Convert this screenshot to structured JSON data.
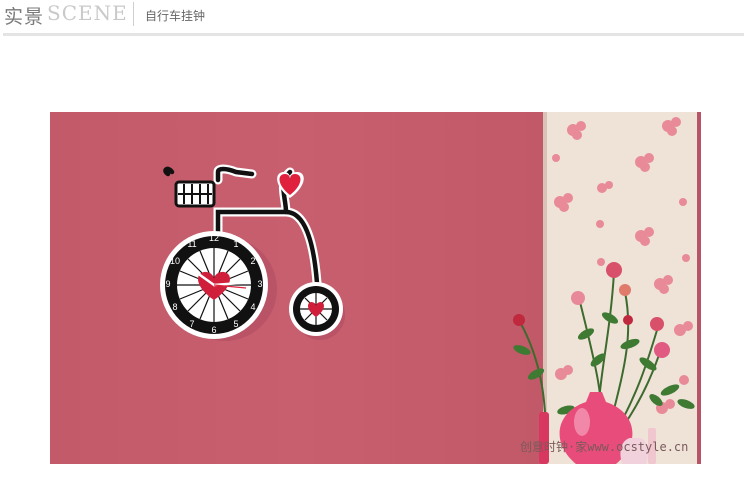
{
  "header": {
    "title_cn": "实景",
    "title_en": "SCENE",
    "subtitle": "自行车挂钟"
  },
  "scene": {
    "image": "bicycle-wall-clock-on-pink-wall",
    "clock_numbers": [
      "12",
      "1",
      "2",
      "3",
      "4",
      "5",
      "6",
      "7",
      "8",
      "9",
      "10",
      "11"
    ],
    "watermark": "创意时钟·家www.ocstyle.cn"
  },
  "colors": {
    "wall": "#c35c6b",
    "wallpaper": "#efe3d8",
    "heart": "#e0213d",
    "clock_frame": "#111111",
    "vase": "#e84c7a"
  }
}
